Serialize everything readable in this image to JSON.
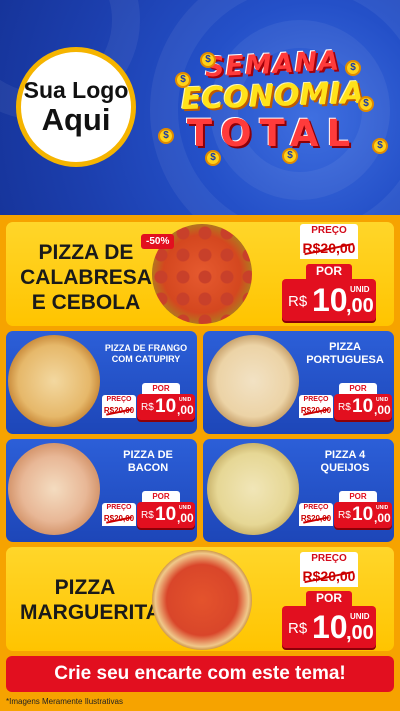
{
  "header": {
    "logo_line1": "Sua Logo",
    "logo_line2": "Aqui",
    "title_line1": "SEMANA",
    "title_line2": "ECONOMIA",
    "title_line3": "TOTAL",
    "coin_symbol": "$"
  },
  "featured": [
    {
      "name_lines": [
        "PIZZA DE",
        "CALABRESA",
        "E CEBOLA"
      ],
      "discount_badge": "-50%",
      "price_label": "PREÇO",
      "old_price": "R$20,00",
      "por_label": "POR",
      "currency": "R$",
      "new_int": "10",
      "new_cents": ",00",
      "unit": "UNID"
    },
    {
      "name_lines": [
        "PIZZA",
        "MARGUERITA"
      ],
      "price_label": "PREÇO",
      "old_price": "R$20,00",
      "por_label": "POR",
      "currency": "R$",
      "new_int": "10",
      "new_cents": ",00",
      "unit": "UNID"
    }
  ],
  "grid": [
    {
      "name_lines": [
        "PIZZA DE FRANGO",
        "COM CATUPIRY"
      ],
      "price_label": "PREÇO",
      "old_price": "R$20,00",
      "por_label": "POR",
      "currency": "R$",
      "new_int": "10",
      "new_cents": ",00",
      "unit": "UNID"
    },
    {
      "name_lines": [
        "PIZZA",
        "PORTUGUESA"
      ],
      "price_label": "PREÇO",
      "old_price": "R$20,00",
      "por_label": "POR",
      "currency": "R$",
      "new_int": "10",
      "new_cents": ",00",
      "unit": "UNID"
    },
    {
      "name_lines": [
        "PIZZA DE",
        "BACON"
      ],
      "price_label": "PREÇO",
      "old_price": "R$20,00",
      "por_label": "POR",
      "currency": "R$",
      "new_int": "10",
      "new_cents": ",00",
      "unit": "UNID"
    },
    {
      "name_lines": [
        "PIZZA 4",
        "QUEIJOS"
      ],
      "price_label": "PREÇO",
      "old_price": "R$20,00",
      "por_label": "POR",
      "currency": "R$",
      "new_int": "10",
      "new_cents": ",00",
      "unit": "UNID"
    }
  ],
  "cta_text": "Crie seu encarte com este tema!",
  "footnote": "*Imagens Meramente Ilustrativas",
  "colors": {
    "blue": "#1d46b8",
    "yellow": "#ffc400",
    "orange": "#f6a300",
    "red": "#e20f1f"
  }
}
